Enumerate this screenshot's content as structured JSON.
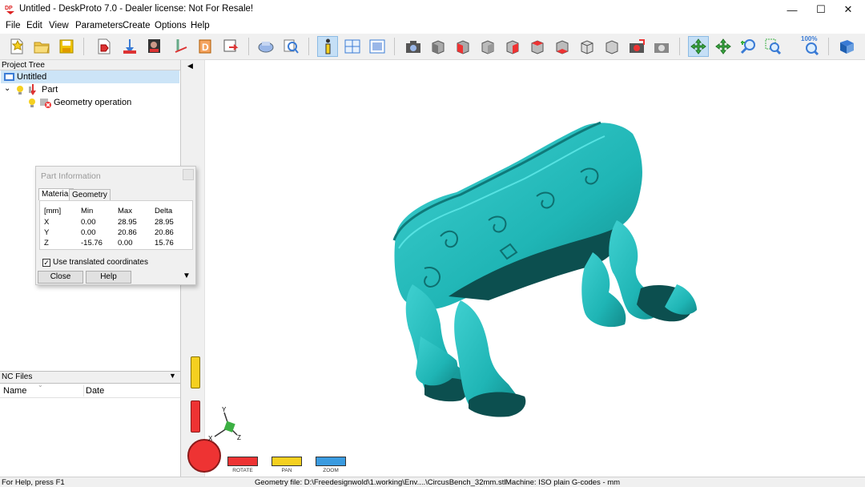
{
  "window": {
    "title": "Untitled - DeskProto 7.0 - Dealer license: Not For Resale!",
    "app_icon_text": "DP",
    "controls": {
      "minimize": "—",
      "maximize": "☐",
      "close": "✕"
    }
  },
  "menu": [
    "File",
    "Edit",
    "View",
    "Parameters",
    "Create",
    "Options",
    "Help"
  ],
  "toolbar": {
    "zoom_label": "100%",
    "icons": [
      "new-file-icon",
      "open-folder-icon",
      "save-icon",
      "import-geometry-icon",
      "place-part-icon",
      "bitmap-icon",
      "vector-icon",
      "drill-icon",
      "export-icon",
      "machine-icon",
      "preview-icon",
      "info-icon",
      "layout-icon",
      "view-frame-icon",
      "camera-icon",
      "view-front-icon",
      "view-top-icon",
      "view-left-icon",
      "view-right-icon",
      "view-back-icon",
      "view-bottom-icon",
      "view-iso-icon",
      "view-iso2-icon",
      "screenshot-icon",
      "render-icon",
      "rotate-icon",
      "pan-icon",
      "zoom-in-icon",
      "zoom-window-icon",
      "zoom-100-icon",
      "help-book-icon"
    ]
  },
  "project_tree": {
    "header": "Project Tree",
    "root": "Untitled",
    "part": "Part",
    "operation": "Geometry operation"
  },
  "nc_files": {
    "header": "NC Files",
    "columns": [
      "Name",
      "Date"
    ]
  },
  "part_info_dialog": {
    "title": "Part Information",
    "tabs": [
      "Material",
      "Geometry"
    ],
    "columns": [
      "[mm]",
      "Min",
      "Max",
      "Delta"
    ],
    "rows": [
      {
        "axis": "X",
        "min": "0.00",
        "max": "28.95",
        "delta": "28.95"
      },
      {
        "axis": "Y",
        "min": "0.00",
        "max": "20.86",
        "delta": "20.86"
      },
      {
        "axis": "Z",
        "min": "-15.76",
        "max": "0.00",
        "delta": "15.76"
      }
    ],
    "checkbox_label": "Use translated coordinates",
    "checkbox_checked": true,
    "close_label": "Close",
    "help_label": "Help"
  },
  "viewport": {
    "model_color": "#1fb5b5",
    "axis_labels": {
      "x": "X",
      "y": "Y",
      "z": "Z"
    },
    "controls": {
      "rotate": "ROTATE",
      "pan": "PAN",
      "zoom": "ZOOM"
    }
  },
  "status": {
    "help": "For Help, press F1",
    "geometry_file": "Geometry file: D:\\Freedesignwold\\1.working\\Env....\\CircusBench_32mm.stl",
    "machine": "Machine: ISO plain G-codes - mm"
  }
}
